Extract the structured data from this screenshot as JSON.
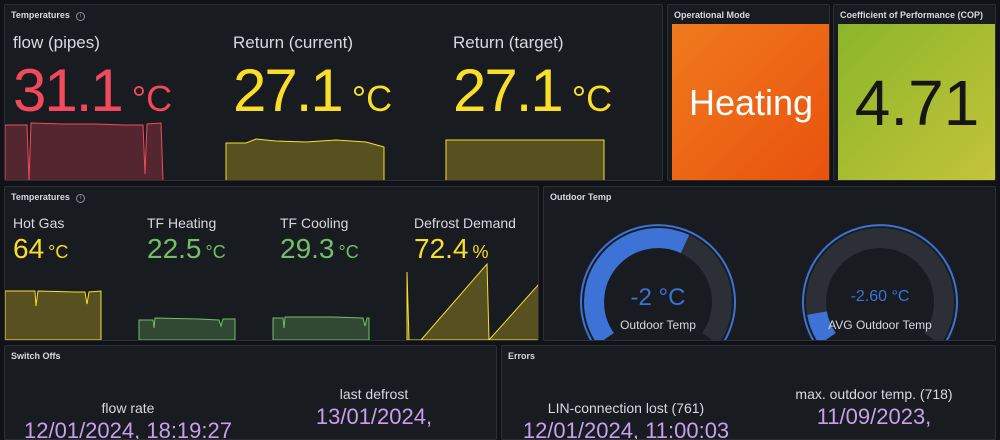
{
  "colors": {
    "red": "#f2495c",
    "yellow": "#fade2a",
    "green": "#73bf69",
    "blue": "#3d72d6",
    "purple": "#c99ef0",
    "orange": "#ff780a",
    "olive": "#96c93d"
  },
  "temps_top": {
    "title": "Temperatures",
    "flow": {
      "label": "flow (pipes)",
      "value": "31.1",
      "unit": "°C"
    },
    "return_current": {
      "label": "Return (current)",
      "value": "27.1",
      "unit": "°C"
    },
    "return_target": {
      "label": "Return (target)",
      "value": "27.1",
      "unit": "°C"
    }
  },
  "op_mode": {
    "title": "Operational Mode",
    "value": "Heating"
  },
  "cop": {
    "title": "Coefficient of Performance (COP)",
    "value": "4.71"
  },
  "temps_bottom": {
    "title": "Temperatures",
    "hot_gas": {
      "label": "Hot Gas",
      "value": "64",
      "unit": "°C"
    },
    "tf_heating": {
      "label": "TF Heating",
      "value": "22.5",
      "unit": "°C"
    },
    "tf_cooling": {
      "label": "TF Cooling",
      "value": "29.3",
      "unit": "°C"
    },
    "defrost": {
      "label": "Defrost Demand",
      "value": "72.4",
      "unit": "%"
    }
  },
  "outdoor": {
    "title": "Outdoor Temp",
    "gauge1": {
      "label": "Outdoor Temp",
      "value": "-2 °C",
      "fill": 0.6
    },
    "gauge2": {
      "label": "AVG Outdoor Temp",
      "value": "-2.60 °C",
      "fill": 0.1
    }
  },
  "switch_offs": {
    "title": "Switch Offs",
    "item1": {
      "label": "flow rate",
      "value": "12/01/2024, 18:19:27"
    },
    "item2": {
      "label": "last defrost",
      "value": "13/01/2024,"
    }
  },
  "errors": {
    "title": "Errors",
    "item1": {
      "label": "LIN-connection lost (761)",
      "value": "12/01/2024, 11:00:03"
    },
    "item2": {
      "label": "max. outdoor temp. (718)",
      "value": "11/09/2023,"
    }
  }
}
